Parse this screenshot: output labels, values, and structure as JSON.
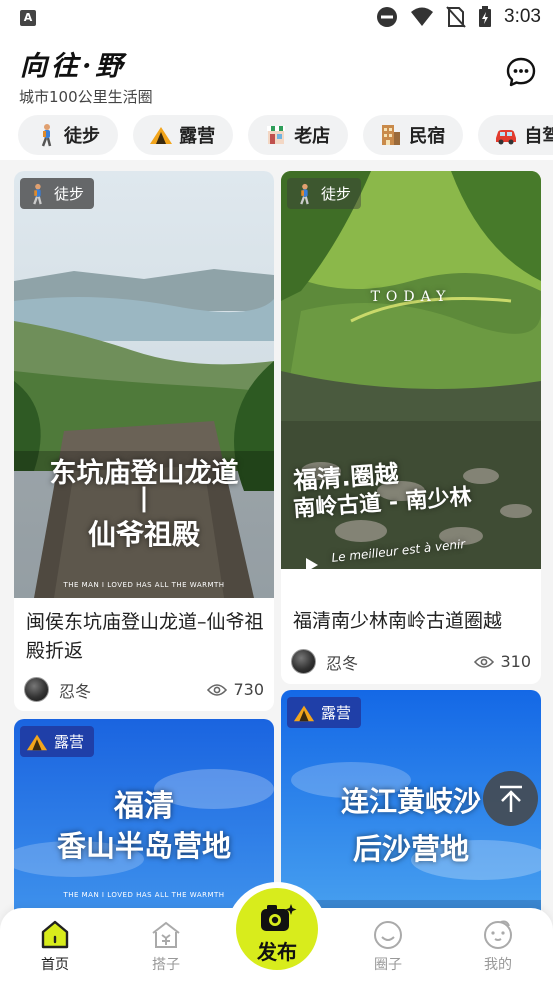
{
  "status_bar": {
    "time": "3:03"
  },
  "header": {
    "logo": "向往·野",
    "slogan": "城市100公里生活圈"
  },
  "categories": [
    {
      "label": "徒步",
      "icon": "hiker-icon"
    },
    {
      "label": "露营",
      "icon": "tent-icon"
    },
    {
      "label": "老店",
      "icon": "shop-icon"
    },
    {
      "label": "民宿",
      "icon": "building-icon"
    },
    {
      "label": "自驾",
      "icon": "car-icon"
    }
  ],
  "feed": {
    "cards": [
      {
        "tag": "徒步",
        "poster_line1": "东坑庙登山龙道",
        "poster_line2": "|",
        "poster_line3": "仙爷祖殿",
        "caption": "THE MAN I LOVED HAS ALL THE WARMTH",
        "title": "闽侯东坑庙登山龙道–仙爷祖殿折返",
        "author": "忍冬",
        "views": "730"
      },
      {
        "tag": "徒步",
        "poster_overlay": "TODAY",
        "poster_line1": "福清.圈越",
        "poster_line2": "南岭古道 - 南少林",
        "poster_script": "Le meilleur est à venir",
        "title": "福清南少林南岭古道圈越",
        "author": "忍冬",
        "views": "310"
      },
      {
        "tag": "露营",
        "poster_line1": "福清",
        "poster_line2": "香山半岛营地",
        "caption": "THE MAN I LOVED HAS ALL THE WARMTH"
      },
      {
        "tag": "露营",
        "poster_line1": "连江黄岐沙",
        "poster_line2": "后沙营地"
      }
    ]
  },
  "bottom_nav": {
    "items": [
      {
        "label": "首页",
        "icon": "home-icon"
      },
      {
        "label": "搭子",
        "icon": "partner-house-icon"
      },
      {
        "label": "圈子",
        "icon": "smile-icon"
      },
      {
        "label": "我的",
        "icon": "profile-face-icon"
      }
    ],
    "publish_label": "发布"
  },
  "colors": {
    "accent": "#d8ec1c",
    "tag_blue": "#1f3fa8"
  }
}
